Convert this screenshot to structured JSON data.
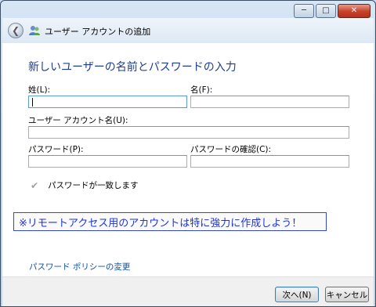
{
  "window": {
    "title": "ユーザー アカウントの追加",
    "controls": {
      "minimize": "─",
      "maximize": "□",
      "close": "✕"
    }
  },
  "header": {
    "back_icon": "back-arrow-icon",
    "app_icon": "user-accounts-icon"
  },
  "page": {
    "heading": "新しいユーザーの名前とパスワードの入力"
  },
  "form": {
    "last_name_label": "姓(L):",
    "first_name_label": "名(F):",
    "account_name_label": "ユーザー アカウント名(U):",
    "password_label": "パスワード(P):",
    "confirm_label": "パスワードの確認(C):",
    "last_name_value": "",
    "first_name_value": "",
    "account_name_value": "",
    "password_value": "",
    "confirm_value": "",
    "match_text": "パスワードが一致します"
  },
  "notice": {
    "text": "※リモートアクセス用のアカウントは特に強力に作成しよう！"
  },
  "link": {
    "policy": "パスワード ポリシーの変更"
  },
  "buttons": {
    "next": "次へ(N)",
    "cancel": "キャンセル"
  }
}
